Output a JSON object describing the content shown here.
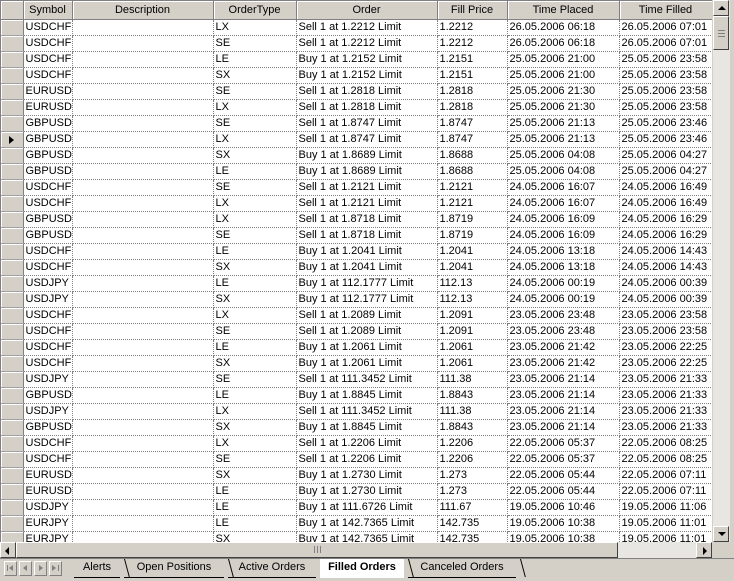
{
  "columns": [
    "Symbol",
    "Description",
    "OrderType",
    "Order",
    "Fill Price",
    "Time Placed",
    "Time Filled"
  ],
  "current_row_index": 7,
  "rows": [
    [
      "USDCHF",
      "",
      "LX",
      "Sell 1 at 1.2212 Limit",
      "1.2212",
      "26.05.2006 06:18",
      "26.05.2006 07:01"
    ],
    [
      "USDCHF",
      "",
      "SE",
      "Sell 1 at 1.2212 Limit",
      "1.2212",
      "26.05.2006 06:18",
      "26.05.2006 07:01"
    ],
    [
      "USDCHF",
      "",
      "LE",
      "Buy 1 at 1.2152 Limit",
      "1.2151",
      "25.05.2006 21:00",
      "25.05.2006 23:58"
    ],
    [
      "USDCHF",
      "",
      "SX",
      "Buy 1 at 1.2152 Limit",
      "1.2151",
      "25.05.2006 21:00",
      "25.05.2006 23:58"
    ],
    [
      "EURUSD",
      "",
      "SE",
      "Sell 1 at 1.2818 Limit",
      "1.2818",
      "25.05.2006 21:30",
      "25.05.2006 23:58"
    ],
    [
      "EURUSD",
      "",
      "LX",
      "Sell 1 at 1.2818 Limit",
      "1.2818",
      "25.05.2006 21:30",
      "25.05.2006 23:58"
    ],
    [
      "GBPUSD",
      "",
      "SE",
      "Sell 1 at 1.8747 Limit",
      "1.8747",
      "25.05.2006 21:13",
      "25.05.2006 23:46"
    ],
    [
      "GBPUSD",
      "",
      "LX",
      "Sell 1 at 1.8747 Limit",
      "1.8747",
      "25.05.2006 21:13",
      "25.05.2006 23:46"
    ],
    [
      "GBPUSD",
      "",
      "SX",
      "Buy 1 at 1.8689 Limit",
      "1.8688",
      "25.05.2006 04:08",
      "25.05.2006 04:27"
    ],
    [
      "GBPUSD",
      "",
      "LE",
      "Buy 1 at 1.8689 Limit",
      "1.8688",
      "25.05.2006 04:08",
      "25.05.2006 04:27"
    ],
    [
      "USDCHF",
      "",
      "SE",
      "Sell 1 at 1.2121 Limit",
      "1.2121",
      "24.05.2006 16:07",
      "24.05.2006 16:49"
    ],
    [
      "USDCHF",
      "",
      "LX",
      "Sell 1 at 1.2121 Limit",
      "1.2121",
      "24.05.2006 16:07",
      "24.05.2006 16:49"
    ],
    [
      "GBPUSD",
      "",
      "LX",
      "Sell 1 at 1.8718 Limit",
      "1.8719",
      "24.05.2006 16:09",
      "24.05.2006 16:29"
    ],
    [
      "GBPUSD",
      "",
      "SE",
      "Sell 1 at 1.8718 Limit",
      "1.8719",
      "24.05.2006 16:09",
      "24.05.2006 16:29"
    ],
    [
      "USDCHF",
      "",
      "LE",
      "Buy 1 at 1.2041 Limit",
      "1.2041",
      "24.05.2006 13:18",
      "24.05.2006 14:43"
    ],
    [
      "USDCHF",
      "",
      "SX",
      "Buy 1 at 1.2041 Limit",
      "1.2041",
      "24.05.2006 13:18",
      "24.05.2006 14:43"
    ],
    [
      "USDJPY",
      "",
      "LE",
      "Buy 1 at 112.1777 Limit",
      "112.13",
      "24.05.2006 00:19",
      "24.05.2006 00:39"
    ],
    [
      "USDJPY",
      "",
      "SX",
      "Buy 1 at 112.1777 Limit",
      "112.13",
      "24.05.2006 00:19",
      "24.05.2006 00:39"
    ],
    [
      "USDCHF",
      "",
      "LX",
      "Sell 1 at 1.2089 Limit",
      "1.2091",
      "23.05.2006 23:48",
      "23.05.2006 23:58"
    ],
    [
      "USDCHF",
      "",
      "SE",
      "Sell 1 at 1.2089 Limit",
      "1.2091",
      "23.05.2006 23:48",
      "23.05.2006 23:58"
    ],
    [
      "USDCHF",
      "",
      "LE",
      "Buy 1 at 1.2061 Limit",
      "1.2061",
      "23.05.2006 21:42",
      "23.05.2006 22:25"
    ],
    [
      "USDCHF",
      "",
      "SX",
      "Buy 1 at 1.2061 Limit",
      "1.2061",
      "23.05.2006 21:42",
      "23.05.2006 22:25"
    ],
    [
      "USDJPY",
      "",
      "SE",
      "Sell 1 at 111.3452 Limit",
      "111.38",
      "23.05.2006 21:14",
      "23.05.2006 21:33"
    ],
    [
      "GBPUSD",
      "",
      "LE",
      "Buy 1 at 1.8845 Limit",
      "1.8843",
      "23.05.2006 21:14",
      "23.05.2006 21:33"
    ],
    [
      "USDJPY",
      "",
      "LX",
      "Sell 1 at 111.3452 Limit",
      "111.38",
      "23.05.2006 21:14",
      "23.05.2006 21:33"
    ],
    [
      "GBPUSD",
      "",
      "SX",
      "Buy 1 at 1.8845 Limit",
      "1.8843",
      "23.05.2006 21:14",
      "23.05.2006 21:33"
    ],
    [
      "USDCHF",
      "",
      "LX",
      "Sell 1 at 1.2206 Limit",
      "1.2206",
      "22.05.2006 05:37",
      "22.05.2006 08:25"
    ],
    [
      "USDCHF",
      "",
      "SE",
      "Sell 1 at 1.2206 Limit",
      "1.2206",
      "22.05.2006 05:37",
      "22.05.2006 08:25"
    ],
    [
      "EURUSD",
      "",
      "SX",
      "Buy 1 at 1.2730 Limit",
      "1.273",
      "22.05.2006 05:44",
      "22.05.2006 07:11"
    ],
    [
      "EURUSD",
      "",
      "LE",
      "Buy 1 at 1.2730 Limit",
      "1.273",
      "22.05.2006 05:44",
      "22.05.2006 07:11"
    ],
    [
      "USDJPY",
      "",
      "LE",
      "Buy 1 at 111.6726 Limit",
      "111.67",
      "19.05.2006 10:46",
      "19.05.2006 11:06"
    ],
    [
      "EURJPY",
      "",
      "LE",
      "Buy 1 at 142.7365 Limit",
      "142.735",
      "19.05.2006 10:38",
      "19.05.2006 11:01"
    ],
    [
      "EURJPY",
      "",
      "SX",
      "Buy 1 at 142.7365 Limit",
      "142.735",
      "19.05.2006 10:38",
      "19.05.2006 11:01"
    ]
  ],
  "tabs": [
    {
      "label": "Alerts",
      "active": false
    },
    {
      "label": "Open Positions",
      "active": false
    },
    {
      "label": "Active Orders",
      "active": false
    },
    {
      "label": "Filled Orders",
      "active": true
    },
    {
      "label": "Canceled Orders",
      "active": false
    }
  ]
}
